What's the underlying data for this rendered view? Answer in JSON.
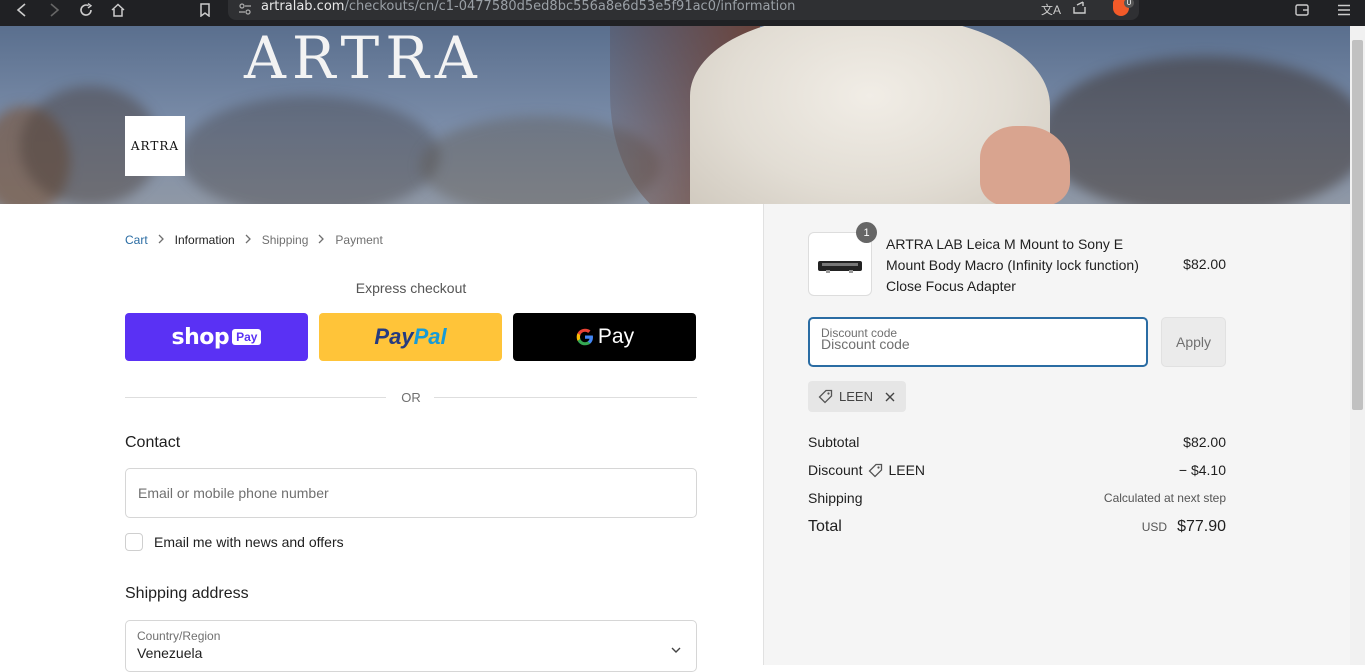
{
  "browser": {
    "url_domain": "artralab.com",
    "url_path": "/checkouts/cn/c1-0477580d5ed8bc556a8e6d53e5f91ac0/information",
    "brave_badge": "0"
  },
  "hero": {
    "brand_text": "ARTRA"
  },
  "logo": {
    "text": "ARTRA"
  },
  "breadcrumb": {
    "cart": "Cart",
    "information": "Information",
    "shipping": "Shipping",
    "payment": "Payment"
  },
  "express": {
    "title": "Express checkout",
    "shop_label": "shop",
    "shop_pay_badge": "Pay",
    "paypal_label_1": "Pay",
    "paypal_label_2": "Pal",
    "gpay_label": "Pay"
  },
  "divider": {
    "or": "OR"
  },
  "contact": {
    "heading": "Contact",
    "email_placeholder": "Email or mobile phone number",
    "newsletter_label": "Email me with news and offers"
  },
  "shipping_address": {
    "heading": "Shipping address",
    "country_label": "Country/Region",
    "country_value": "Venezuela"
  },
  "order": {
    "product_name": "ARTRA LAB Leica M Mount to Sony E Mount Body Macro (Infinity lock function) Close Focus Adapter",
    "product_qty": "1",
    "product_price": "$82.00",
    "discount_label": "Discount code",
    "discount_placeholder": "Discount code",
    "apply_label": "Apply",
    "applied_code": "LEEN",
    "subtotal_label": "Subtotal",
    "subtotal_value": "$82.00",
    "discount_row_label": "Discount",
    "discount_code": "LEEN",
    "discount_value": "− $4.10",
    "shipping_label": "Shipping",
    "shipping_value": "Calculated at next step",
    "total_label": "Total",
    "currency": "USD",
    "total_value": "$77.90"
  },
  "colors": {
    "shop_pay": "#5a31f4",
    "paypal": "#ffc439",
    "gpay": "#000000",
    "link": "#2a6ca3"
  }
}
